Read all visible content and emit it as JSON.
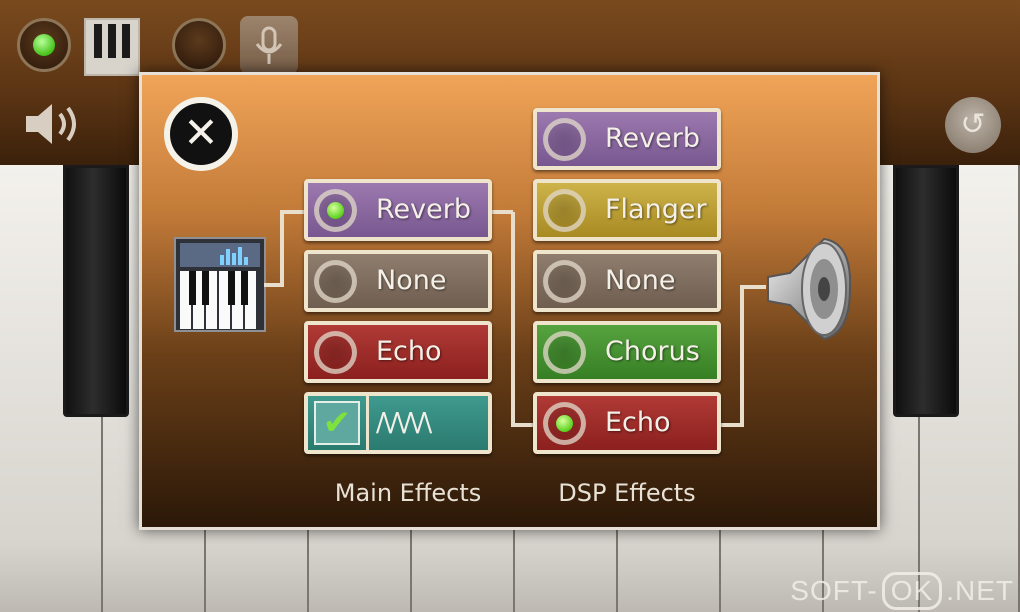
{
  "toolbar": {
    "buttons": [
      "record-toggle",
      "keyboard",
      "playback",
      "microphone",
      "volume",
      "reset"
    ]
  },
  "dialog": {
    "close_symbol": "✕",
    "main_effects": {
      "title": "Main Effects",
      "items": [
        {
          "label": "Reverb",
          "color": "#8a68a0",
          "active": true
        },
        {
          "label": "None",
          "color": "#7f6e60",
          "active": false
        },
        {
          "label": "Echo",
          "color": "#9e2e2b",
          "active": false
        }
      ],
      "wave_toggle": {
        "checked": true,
        "check_symbol": "✔",
        "wave_symbol": "/\\/\\/\\/\\"
      }
    },
    "dsp_effects": {
      "title": "DSP Effects",
      "items": [
        {
          "label": "Reverb",
          "color": "#8a68a0",
          "active": false
        },
        {
          "label": "Flanger",
          "color": "#bb9f36",
          "active": false
        },
        {
          "label": "None",
          "color": "#7f6e60",
          "active": false
        },
        {
          "label": "Chorus",
          "color": "#479231",
          "active": false
        },
        {
          "label": "Echo",
          "color": "#9e2e2b",
          "active": true
        }
      ]
    }
  },
  "watermark": {
    "left": "SOFT-",
    "mid": "OK",
    "right": ".NET"
  },
  "icons": [
    "record-dot-icon",
    "piano-keys-icon",
    "circle-icon",
    "microphone-icon",
    "speaker-icon",
    "refresh-icon",
    "close-icon",
    "synthesizer-icon",
    "loudspeaker-icon",
    "checkmark-icon"
  ]
}
